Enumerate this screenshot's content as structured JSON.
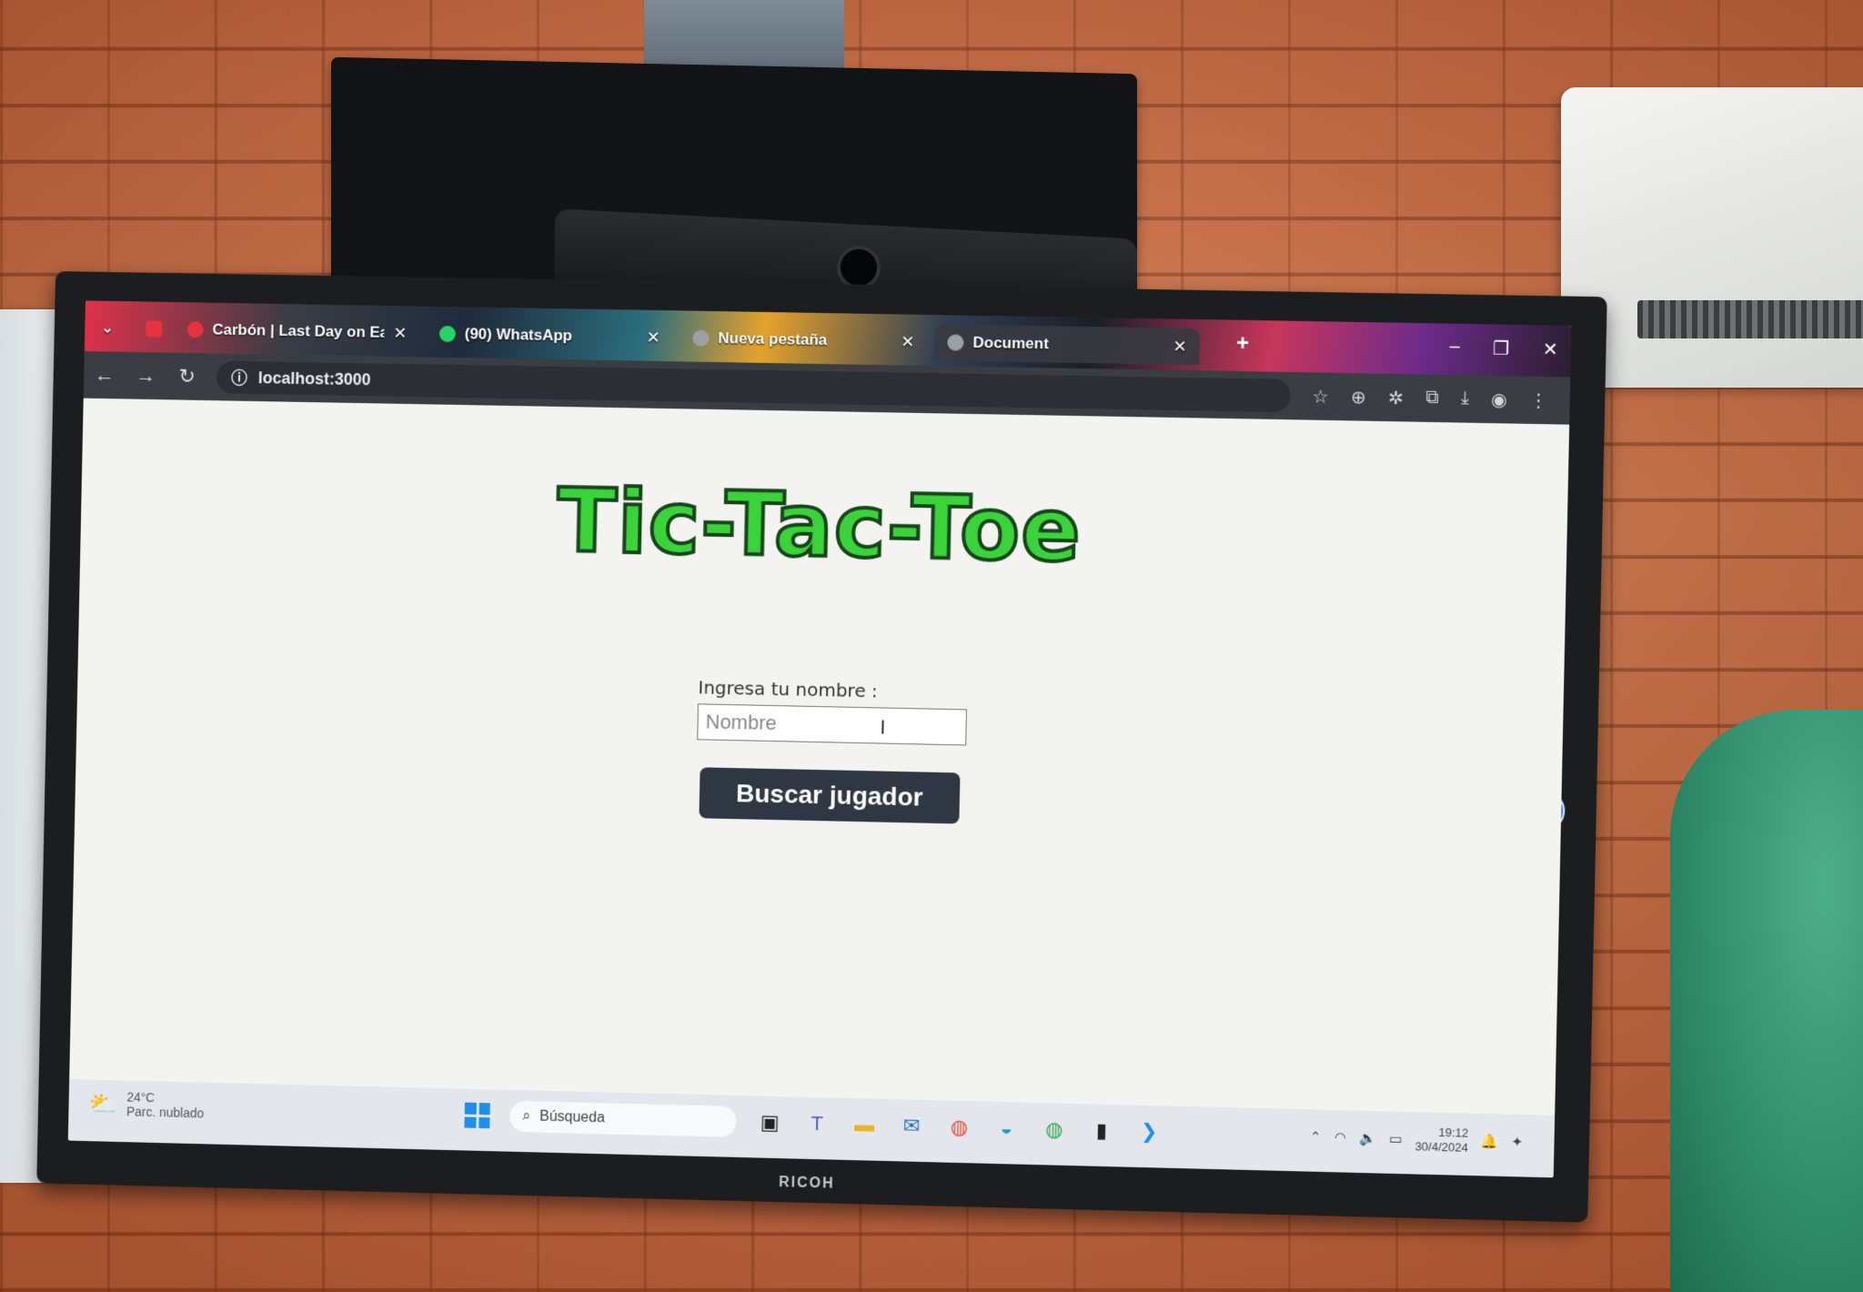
{
  "browser": {
    "tabs": [
      {
        "title": "Carbón | Last Day on Earth: Su",
        "fav_color": "#e8333f"
      },
      {
        "title": "(90) WhatsApp",
        "fav_color": "#25d366"
      },
      {
        "title": "Nueva pestaña",
        "fav_color": "#9aa0a6"
      },
      {
        "title": "Document",
        "fav_color": "#9aa0a6"
      }
    ],
    "url": "localhost:3000"
  },
  "page": {
    "title": "Tic-Tac-Toe",
    "name_label": "Ingresa tu nombre :",
    "name_placeholder": "Nombre",
    "search_button": "Buscar jugador"
  },
  "taskbar": {
    "weather_temp": "24°C",
    "weather_desc": "Parc. nublado",
    "search_placeholder": "Búsqueda",
    "time": "19:12",
    "date": "30/4/2024"
  },
  "tv": {
    "brand": "RICOH"
  },
  "colors": {
    "title_green": "#3ad43a",
    "button_bg": "#2e3742",
    "accent_blue": "#1f8ee8"
  }
}
